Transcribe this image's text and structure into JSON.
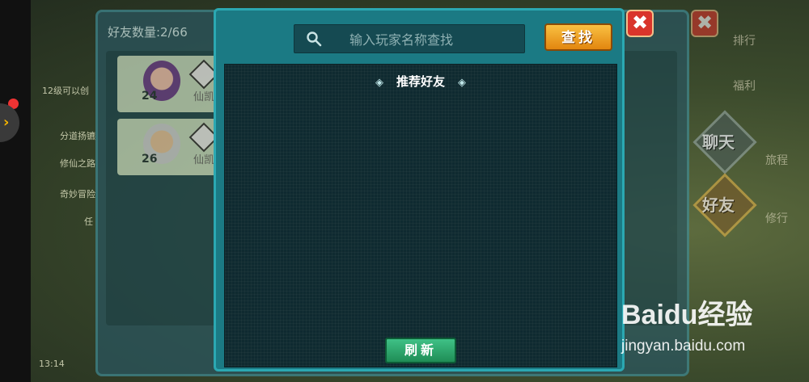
{
  "friends_panel": {
    "count_label": "好友数量:2/66",
    "friends": [
      {
        "level": "24",
        "name": "仙凯"
      },
      {
        "level": "26",
        "name": "仙凯"
      }
    ]
  },
  "dialog": {
    "search_placeholder": "输入玩家名称查找",
    "find_button": "查找",
    "recommend_title": "推荐好友",
    "refresh_button": "刷新"
  },
  "close_icon_label": "✖",
  "hud": {
    "items": [
      "排行",
      "福利",
      "旅程",
      "修行"
    ],
    "chat_label": "聊天",
    "friends_label": "好友"
  },
  "side_chat": [
    "12级可以创",
    "分道扬镳",
    "修仙之路",
    "奇妙冒险",
    "任"
  ],
  "status_time": "13:14",
  "watermark": {
    "logo": "Baidu经验",
    "url": "jingyan.baidu.com"
  },
  "colors": {
    "dialog_bg": "#1b7a84",
    "find_button": "#f0a02a",
    "refresh_button": "#2fa86d",
    "close_button": "#d9342b"
  }
}
